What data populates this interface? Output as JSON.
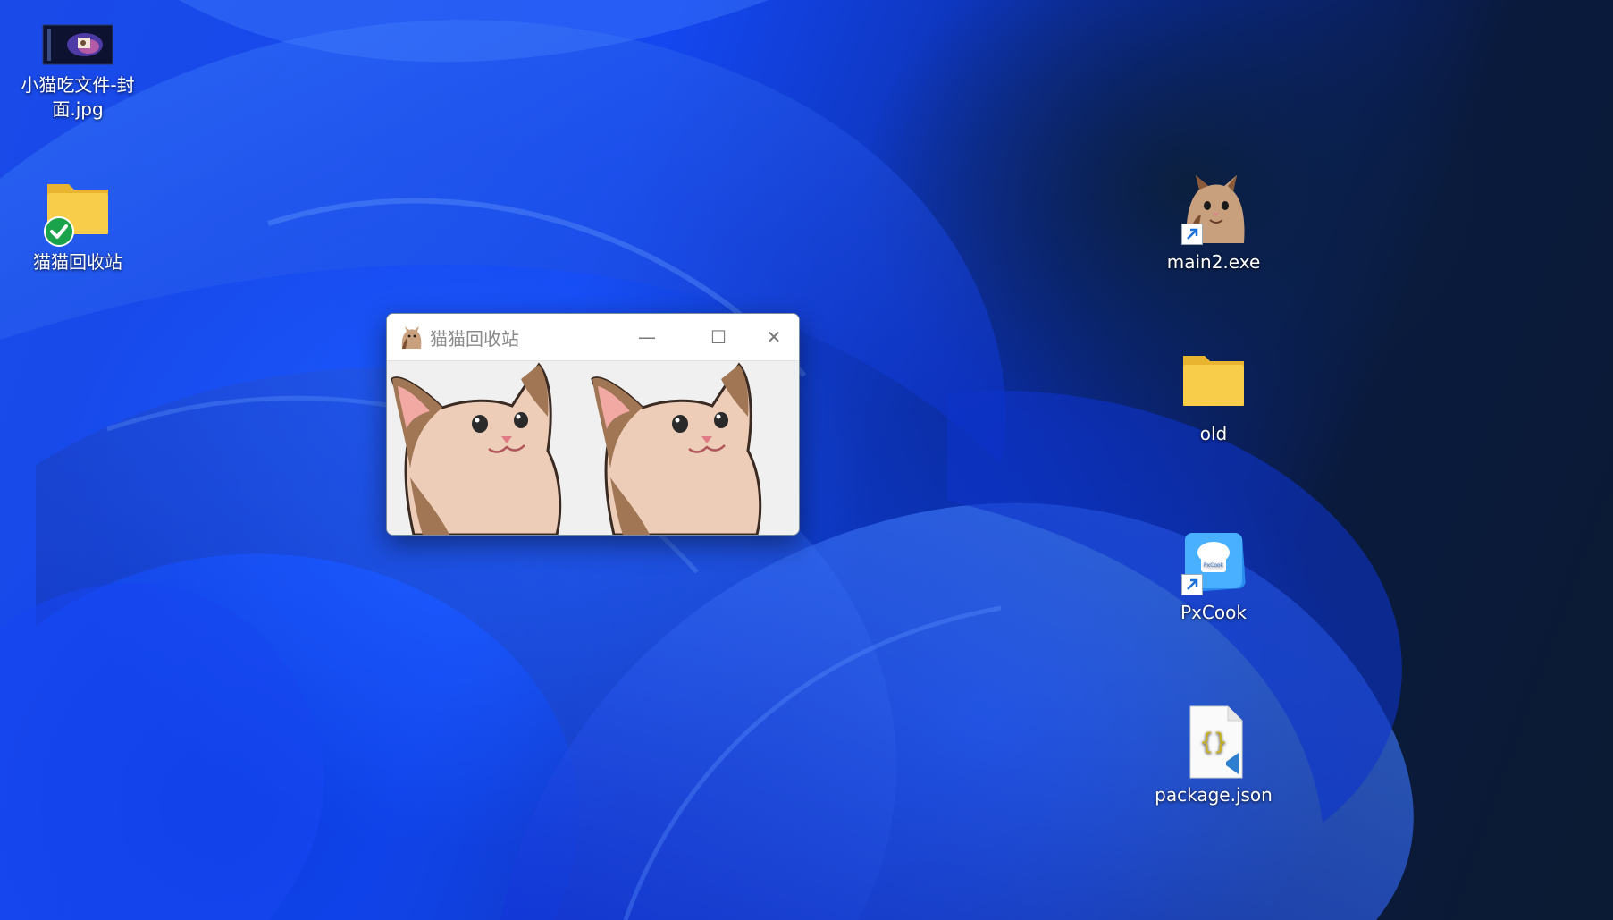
{
  "desktop": {
    "icons": [
      {
        "label": "小猫吃文件-封面.jpg",
        "type": "image"
      },
      {
        "label": "猫猫回收站",
        "type": "folder"
      },
      {
        "label": "main2.exe",
        "type": "app-shortcut"
      },
      {
        "label": "old",
        "type": "folder"
      },
      {
        "label": "PxCook",
        "type": "app-shortcut",
        "logo_text": "PxCook"
      },
      {
        "label": "package.json",
        "type": "json-file",
        "glyph": "{}"
      }
    ]
  },
  "window": {
    "title": "猫猫回收站",
    "controls": {
      "minimize": "—",
      "maximize": "☐",
      "close": "✕"
    }
  },
  "colors": {
    "folder_yellow": "#f6c945",
    "check_green": "#1aa34a",
    "accent_blue": "#1a4be8"
  }
}
